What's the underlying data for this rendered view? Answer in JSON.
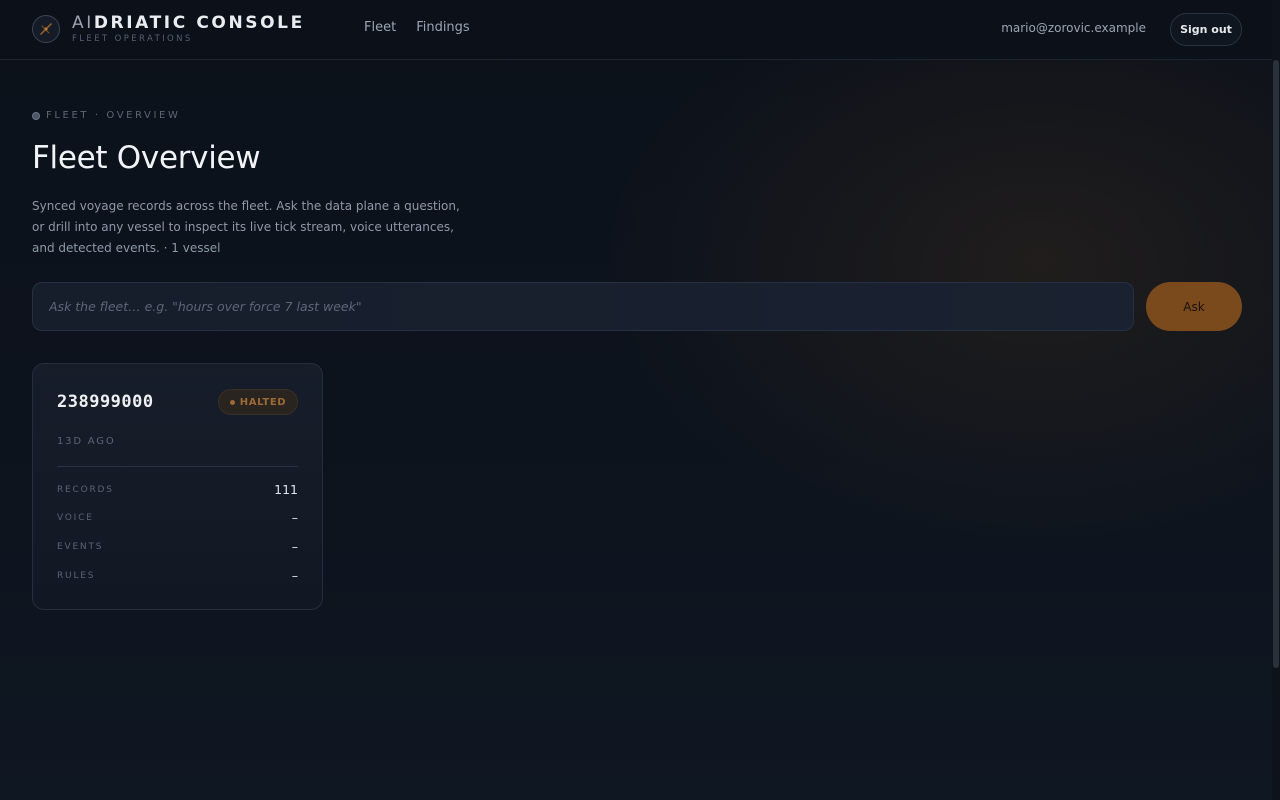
{
  "header": {
    "brand_prefix": "AI",
    "brand_rest": "DRIATIC CONSOLE",
    "brand_subtitle": "FLEET OPERATIONS",
    "logo_icon": "compass-icon",
    "nav": [
      {
        "label": "Fleet"
      },
      {
        "label": "Findings"
      }
    ],
    "user_email": "mario@zorovic.example",
    "sign_out_label": "Sign out"
  },
  "page": {
    "breadcrumb": "FLEET · OVERVIEW",
    "title": "Fleet Overview",
    "description": "Synced voyage records across the fleet. Ask the data plane a question, or drill into any vessel to inspect its live tick stream, voice utterances, and detected events. · 1 vessel"
  },
  "ask": {
    "placeholder": "Ask the fleet… e.g. \"hours over force 7 last week\"",
    "value": "",
    "button_label": "Ask"
  },
  "vessels": [
    {
      "id": "238999000",
      "status": "HALTED",
      "status_color": "#9b6a35",
      "last_seen": "13D AGO",
      "stats": [
        {
          "label": "RECORDS",
          "value": "111"
        },
        {
          "label": "VOICE",
          "value": "–"
        },
        {
          "label": "EVENTS",
          "value": "–"
        },
        {
          "label": "RULES",
          "value": "–"
        }
      ]
    }
  ],
  "colors": {
    "accent": "#7a4a1c",
    "background": "#0c111a"
  }
}
